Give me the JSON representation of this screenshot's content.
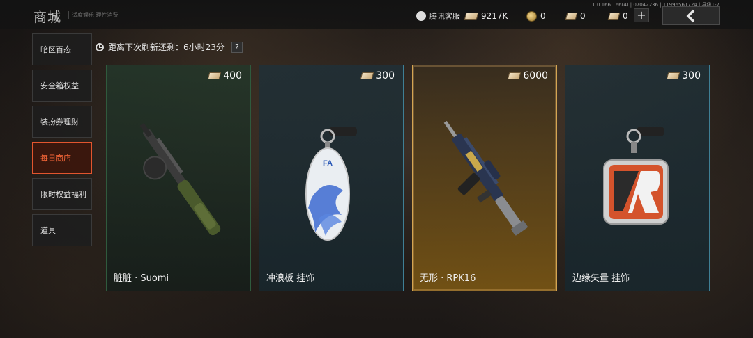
{
  "header": {
    "title": "商城",
    "subtitle": "适度娱乐 理性消费",
    "version": "1.0.166.166(4) | 07042236 | 11996561724 | 县级1-7",
    "customer_service": "腾讯客服",
    "currencies": [
      {
        "icon": "ticket-icon",
        "value": "9217K"
      },
      {
        "icon": "coin-icon",
        "value": "0"
      },
      {
        "icon": "voucher-icon",
        "value": "0"
      },
      {
        "icon": "ticket-icon",
        "value": "0"
      }
    ],
    "plus": "+",
    "back": "‹"
  },
  "sidebar": {
    "items": [
      {
        "label": "暗区百态"
      },
      {
        "label": "安全箱权益"
      },
      {
        "label": "装扮券理财"
      },
      {
        "label": "每日商店",
        "active": true
      },
      {
        "label": "限时权益福利"
      },
      {
        "label": "道具"
      }
    ]
  },
  "refresh": {
    "text": "距离下次刷新还剩：6小时23分",
    "help": "?"
  },
  "cards": [
    {
      "name": "脏脏 · Suomi",
      "price": "400",
      "rarity_color": "#2f5a3d"
    },
    {
      "name": "冲浪板 挂饰",
      "price": "300",
      "rarity_color": "#3f7f95"
    },
    {
      "name": "无形 · RPK16",
      "price": "6000",
      "rarity_color": "#d4a552"
    },
    {
      "name": "边缘矢量 挂饰",
      "price": "300",
      "rarity_color": "#3f7f95"
    }
  ]
}
